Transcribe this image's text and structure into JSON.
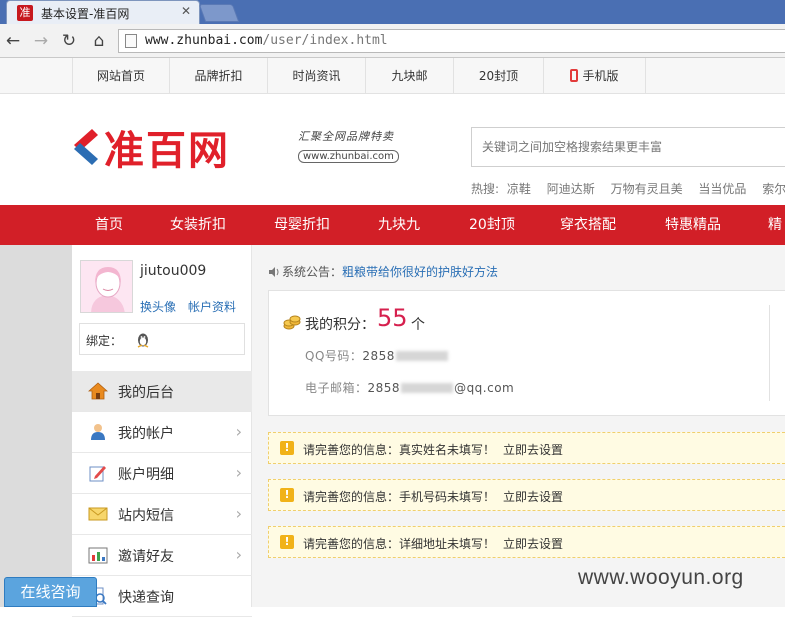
{
  "browser": {
    "tab_title": "基本设置-准百网",
    "favicon_text": "准",
    "url_host": "www.zhunbai.com",
    "url_path": "/user/index.html"
  },
  "toplinks": [
    {
      "label": "网站首页"
    },
    {
      "label": "品牌折扣"
    },
    {
      "label": "时尚资讯"
    },
    {
      "label": "九块邮"
    },
    {
      "label": "20封顶"
    },
    {
      "label": "手机版"
    }
  ],
  "header": {
    "logo_text": "准百网",
    "slogan": "汇聚全网品牌特卖",
    "slogan_url": "www.zhunbai.com",
    "search_placeholder": "关键词之间加空格搜索结果更丰富",
    "hot_label": "热搜:",
    "hot_words": [
      "凉鞋",
      "阿迪达斯",
      "万物有灵且美",
      "当当优品",
      "索尔诺"
    ]
  },
  "mainnav": [
    {
      "label": "首页"
    },
    {
      "label": "女装折扣"
    },
    {
      "label": "母婴折扣"
    },
    {
      "label": "九块九"
    },
    {
      "label": "20封顶"
    },
    {
      "label": "穿衣搭配"
    },
    {
      "label": "特惠精品"
    },
    {
      "label": "精彩"
    }
  ],
  "sidebar": {
    "username": "jiutou009",
    "change_avatar": "换头像",
    "account_info": "帐户资料",
    "bind_label": "绑定：",
    "menu": [
      {
        "label": "我的后台",
        "icon": "home-icon"
      },
      {
        "label": "我的帐户",
        "icon": "user-icon"
      },
      {
        "label": "账户明细",
        "icon": "edit-icon"
      },
      {
        "label": "站内短信",
        "icon": "mail-icon"
      },
      {
        "label": "邀请好友",
        "icon": "chart-icon"
      },
      {
        "label": "快递查询",
        "icon": "search-icon"
      }
    ]
  },
  "main": {
    "notice_label": "系统公告：",
    "notice_link": "粗粮带给你很好的护肤好方法",
    "points_label": "我的积分：",
    "points_value": "55",
    "points_unit": "个",
    "qq_label": "QQ号码：",
    "qq_prefix": "2858",
    "email_label": "电子邮箱：",
    "email_prefix": "2858",
    "email_suffix": "@qq.com",
    "alerts": [
      {
        "text": "请完善您的信息：真实姓名未填写！",
        "link": "立即去设置"
      },
      {
        "text": "请完善您的信息：手机号码未填写！",
        "link": "立即去设置"
      },
      {
        "text": "请完善您的信息：详细地址未填写！",
        "link": "立即去设置"
      }
    ]
  },
  "consult_label": "在线咨询",
  "watermark": "www.wooyun.org",
  "colors": {
    "brand_red": "#d21f27",
    "points_pink": "#d6204e",
    "link_blue": "#2a6fb5",
    "alert_bg": "#fffbe3"
  }
}
